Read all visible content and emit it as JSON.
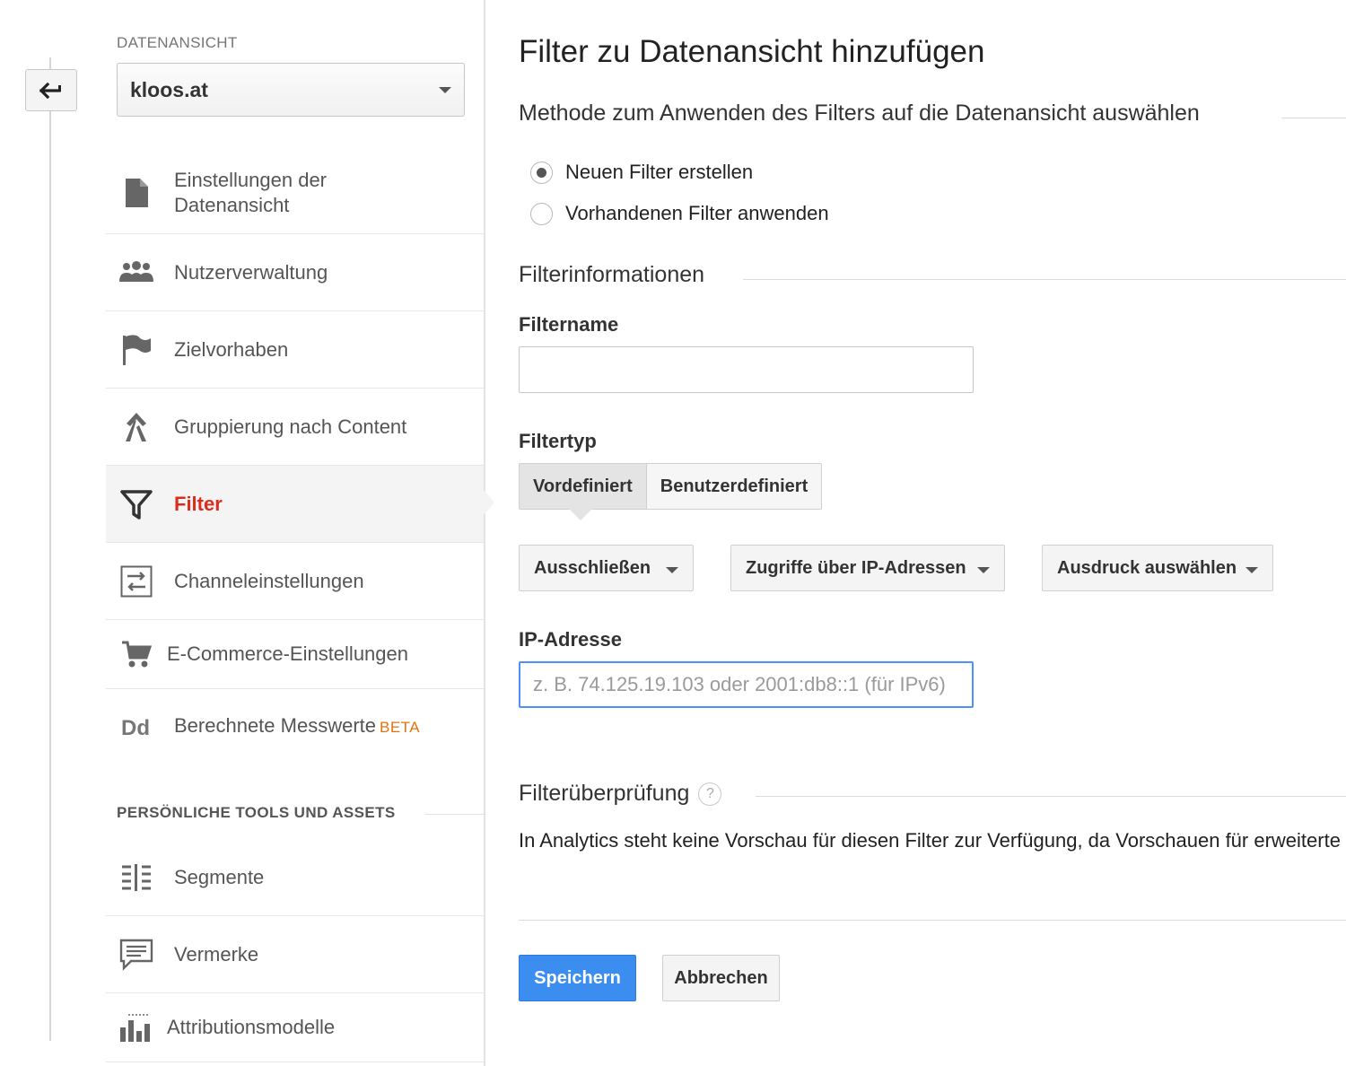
{
  "sidebar": {
    "view_label": "DATENANSICHT",
    "view_select": "kloos.at",
    "items": [
      {
        "label": "Einstellungen der Datenansicht",
        "icon": "document-icon"
      },
      {
        "label": "Nutzerverwaltung",
        "icon": "users-icon"
      },
      {
        "label": "Zielvorhaben",
        "icon": "flag-icon"
      },
      {
        "label": "Gruppierung nach Content",
        "icon": "content-grouping-icon"
      },
      {
        "label": "Filter",
        "icon": "filter-icon",
        "active": true
      },
      {
        "label": "Channeleinstellungen",
        "icon": "channel-settings-icon"
      },
      {
        "label": "E-Commerce-Einstellungen",
        "icon": "cart-icon"
      },
      {
        "label": "Berechnete Messwerte",
        "badge": "BETA",
        "icon": "dd-icon"
      }
    ],
    "section2_label": "PERSÖNLICHE TOOLS UND ASSETS",
    "items2": [
      {
        "label": "Segmente",
        "icon": "segments-icon"
      },
      {
        "label": "Vermerke",
        "icon": "annotations-icon"
      },
      {
        "label": "Attributionsmodelle",
        "icon": "attribution-icon"
      }
    ]
  },
  "main": {
    "title": "Filter zu Datenansicht hinzufügen",
    "method_heading": "Methode zum Anwenden des Filters auf die Datenansicht auswählen",
    "radio_new": "Neuen Filter erstellen",
    "radio_existing": "Vorhandenen Filter anwenden",
    "info_heading": "Filterinformationen",
    "filtername_label": "Filtername",
    "filtername_value": "",
    "filtertype_label": "Filtertyp",
    "tab_predefined": "Vordefiniert",
    "tab_custom": "Benutzerdefiniert",
    "dd_action": "Ausschließen",
    "dd_source": "Zugriffe über IP-Adressen",
    "dd_expression": "Ausdruck auswählen",
    "ip_label": "IP-Adresse",
    "ip_placeholder": "z. B. 74.125.19.103 oder 2001:db8::1 (für IPv6)",
    "verify_heading": "Filterüberprüfung",
    "help_glyph": "?",
    "verify_text": "In Analytics steht keine Vorschau für diesen Filter zur Verfügung, da Vorschauen für erweiterte Filter nicht möglich sind.",
    "save_label": "Speichern",
    "cancel_label": "Abbrechen"
  },
  "colors": {
    "accent_active": "#dd2c1f",
    "primary_button": "#3b8ef0",
    "focus_border": "#4d90fe",
    "beta": "#e8710a"
  }
}
